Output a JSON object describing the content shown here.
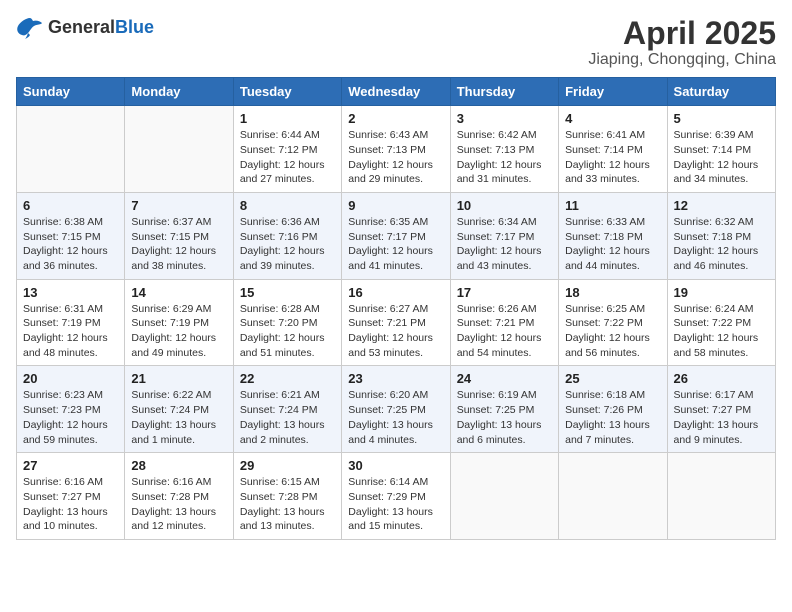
{
  "header": {
    "logo_general": "General",
    "logo_blue": "Blue",
    "month_title": "April 2025",
    "location": "Jiaping, Chongqing, China"
  },
  "days_of_week": [
    "Sunday",
    "Monday",
    "Tuesday",
    "Wednesday",
    "Thursday",
    "Friday",
    "Saturday"
  ],
  "weeks": [
    [
      {
        "day": "",
        "info": ""
      },
      {
        "day": "",
        "info": ""
      },
      {
        "day": "1",
        "info": "Sunrise: 6:44 AM\nSunset: 7:12 PM\nDaylight: 12 hours and 27 minutes."
      },
      {
        "day": "2",
        "info": "Sunrise: 6:43 AM\nSunset: 7:13 PM\nDaylight: 12 hours and 29 minutes."
      },
      {
        "day": "3",
        "info": "Sunrise: 6:42 AM\nSunset: 7:13 PM\nDaylight: 12 hours and 31 minutes."
      },
      {
        "day": "4",
        "info": "Sunrise: 6:41 AM\nSunset: 7:14 PM\nDaylight: 12 hours and 33 minutes."
      },
      {
        "day": "5",
        "info": "Sunrise: 6:39 AM\nSunset: 7:14 PM\nDaylight: 12 hours and 34 minutes."
      }
    ],
    [
      {
        "day": "6",
        "info": "Sunrise: 6:38 AM\nSunset: 7:15 PM\nDaylight: 12 hours and 36 minutes."
      },
      {
        "day": "7",
        "info": "Sunrise: 6:37 AM\nSunset: 7:15 PM\nDaylight: 12 hours and 38 minutes."
      },
      {
        "day": "8",
        "info": "Sunrise: 6:36 AM\nSunset: 7:16 PM\nDaylight: 12 hours and 39 minutes."
      },
      {
        "day": "9",
        "info": "Sunrise: 6:35 AM\nSunset: 7:17 PM\nDaylight: 12 hours and 41 minutes."
      },
      {
        "day": "10",
        "info": "Sunrise: 6:34 AM\nSunset: 7:17 PM\nDaylight: 12 hours and 43 minutes."
      },
      {
        "day": "11",
        "info": "Sunrise: 6:33 AM\nSunset: 7:18 PM\nDaylight: 12 hours and 44 minutes."
      },
      {
        "day": "12",
        "info": "Sunrise: 6:32 AM\nSunset: 7:18 PM\nDaylight: 12 hours and 46 minutes."
      }
    ],
    [
      {
        "day": "13",
        "info": "Sunrise: 6:31 AM\nSunset: 7:19 PM\nDaylight: 12 hours and 48 minutes."
      },
      {
        "day": "14",
        "info": "Sunrise: 6:29 AM\nSunset: 7:19 PM\nDaylight: 12 hours and 49 minutes."
      },
      {
        "day": "15",
        "info": "Sunrise: 6:28 AM\nSunset: 7:20 PM\nDaylight: 12 hours and 51 minutes."
      },
      {
        "day": "16",
        "info": "Sunrise: 6:27 AM\nSunset: 7:21 PM\nDaylight: 12 hours and 53 minutes."
      },
      {
        "day": "17",
        "info": "Sunrise: 6:26 AM\nSunset: 7:21 PM\nDaylight: 12 hours and 54 minutes."
      },
      {
        "day": "18",
        "info": "Sunrise: 6:25 AM\nSunset: 7:22 PM\nDaylight: 12 hours and 56 minutes."
      },
      {
        "day": "19",
        "info": "Sunrise: 6:24 AM\nSunset: 7:22 PM\nDaylight: 12 hours and 58 minutes."
      }
    ],
    [
      {
        "day": "20",
        "info": "Sunrise: 6:23 AM\nSunset: 7:23 PM\nDaylight: 12 hours and 59 minutes."
      },
      {
        "day": "21",
        "info": "Sunrise: 6:22 AM\nSunset: 7:24 PM\nDaylight: 13 hours and 1 minute."
      },
      {
        "day": "22",
        "info": "Sunrise: 6:21 AM\nSunset: 7:24 PM\nDaylight: 13 hours and 2 minutes."
      },
      {
        "day": "23",
        "info": "Sunrise: 6:20 AM\nSunset: 7:25 PM\nDaylight: 13 hours and 4 minutes."
      },
      {
        "day": "24",
        "info": "Sunrise: 6:19 AM\nSunset: 7:25 PM\nDaylight: 13 hours and 6 minutes."
      },
      {
        "day": "25",
        "info": "Sunrise: 6:18 AM\nSunset: 7:26 PM\nDaylight: 13 hours and 7 minutes."
      },
      {
        "day": "26",
        "info": "Sunrise: 6:17 AM\nSunset: 7:27 PM\nDaylight: 13 hours and 9 minutes."
      }
    ],
    [
      {
        "day": "27",
        "info": "Sunrise: 6:16 AM\nSunset: 7:27 PM\nDaylight: 13 hours and 10 minutes."
      },
      {
        "day": "28",
        "info": "Sunrise: 6:16 AM\nSunset: 7:28 PM\nDaylight: 13 hours and 12 minutes."
      },
      {
        "day": "29",
        "info": "Sunrise: 6:15 AM\nSunset: 7:28 PM\nDaylight: 13 hours and 13 minutes."
      },
      {
        "day": "30",
        "info": "Sunrise: 6:14 AM\nSunset: 7:29 PM\nDaylight: 13 hours and 15 minutes."
      },
      {
        "day": "",
        "info": ""
      },
      {
        "day": "",
        "info": ""
      },
      {
        "day": "",
        "info": ""
      }
    ]
  ]
}
